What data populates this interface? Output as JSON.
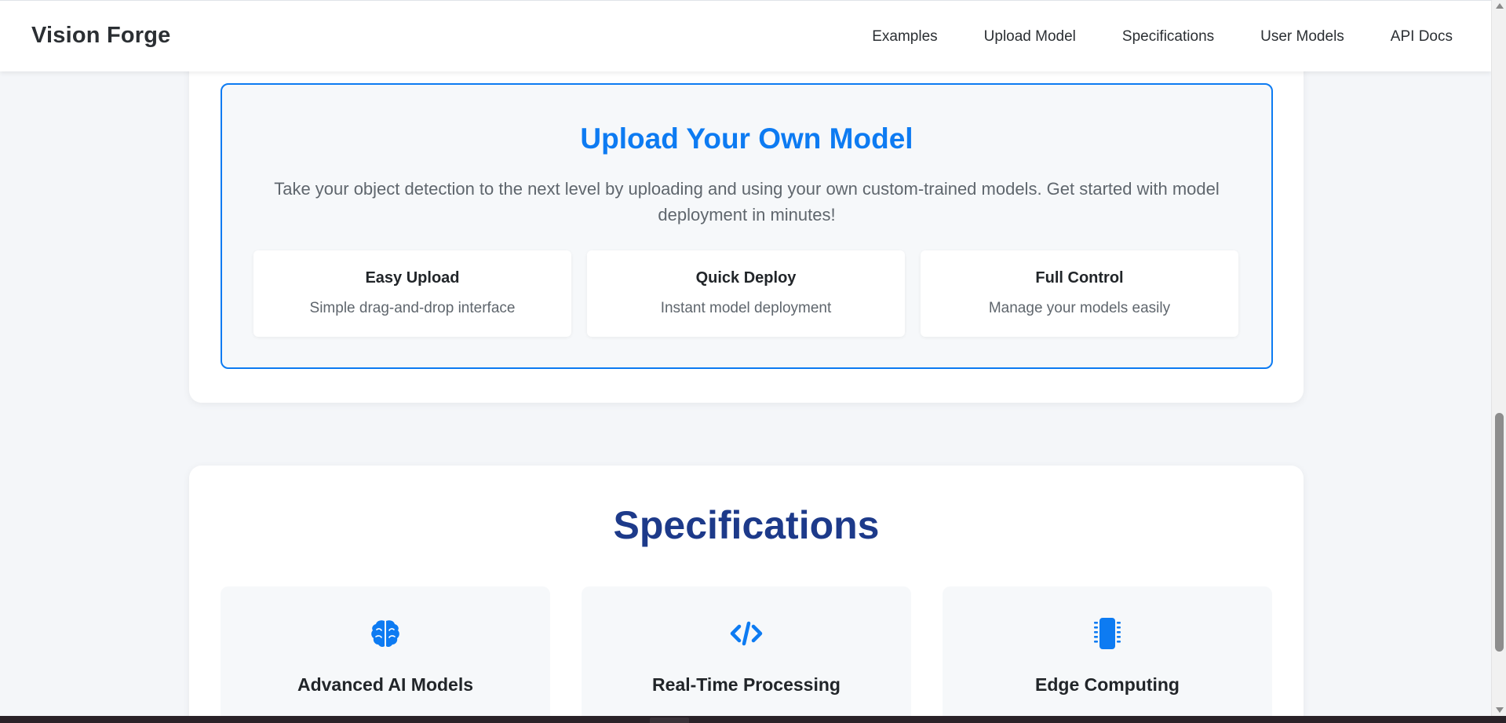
{
  "navbar": {
    "brand": "Vision Forge",
    "links": [
      "Examples",
      "Upload Model",
      "Specifications",
      "User Models",
      "API Docs"
    ]
  },
  "upload": {
    "title": "Upload Your Own Model",
    "description": "Take your object detection to the next level by uploading and using your own custom-trained models. Get started with model deployment in minutes!",
    "features": [
      {
        "title": "Easy Upload",
        "description": "Simple drag-and-drop interface"
      },
      {
        "title": "Quick Deploy",
        "description": "Instant model deployment"
      },
      {
        "title": "Full Control",
        "description": "Manage your models easily"
      }
    ]
  },
  "specs": {
    "title": "Specifications",
    "cards": [
      {
        "title": "Advanced AI Models",
        "icon": "brain-icon"
      },
      {
        "title": "Real-Time Processing",
        "icon": "code-icon"
      },
      {
        "title": "Edge Computing",
        "icon": "microchip-icon"
      }
    ]
  },
  "colors": {
    "accent": "#0d7bf2",
    "heading_dark_blue": "#1d3a8a",
    "page_background": "#f4f6f9"
  }
}
